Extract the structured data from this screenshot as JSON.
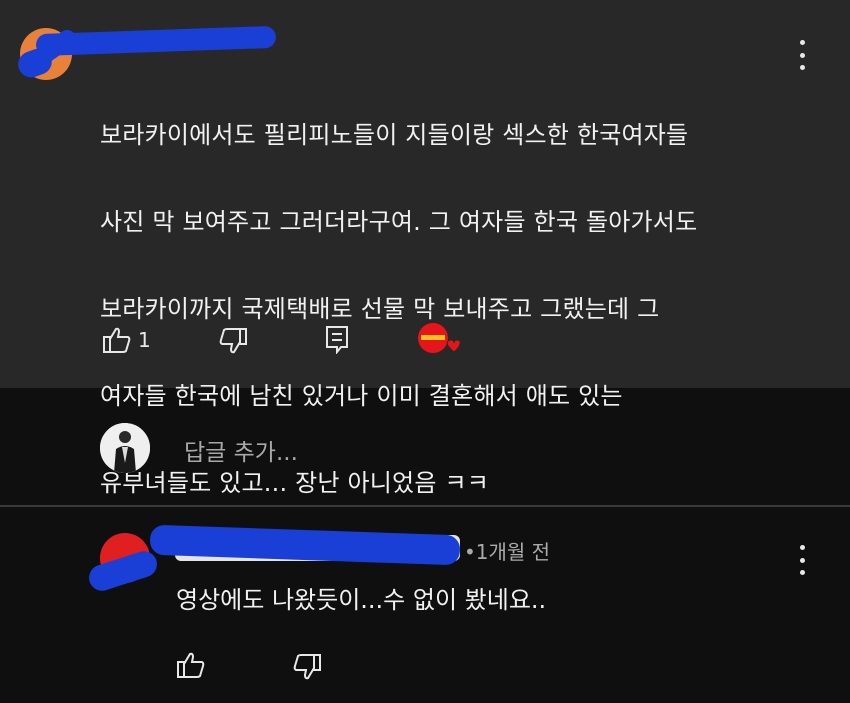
{
  "top_comment": {
    "text_lines": [
      "보라카이에서도 필리피노들이 지들이랑 섹스한 한국여자들",
      "사진 막 보여주고 그러더라구여.  그 여자들 한국 돌아가서도",
      "보라카이까지 국제택배로 선물 막 보내주고 그랬는데 그",
      "여자들 한국에 남친 있거나 이미 결혼해서 애도 있는",
      "유부녀들도 있고... 장난 아니었음 ㅋㅋ"
    ],
    "like_count": "1"
  },
  "reply_input": {
    "placeholder": "답글 추가..."
  },
  "second_comment": {
    "meta": "•1개월 전",
    "text": "영상에도 나왔듯이...수 없이 봤네요.."
  },
  "icons": [
    "like-icon",
    "dislike-icon",
    "reply-icon",
    "creator-heart-icon",
    "more-options-icon"
  ],
  "colors": {
    "background": "#0f0f0f",
    "comment_highlight": "#282828",
    "redaction": "#1a3fd6"
  }
}
